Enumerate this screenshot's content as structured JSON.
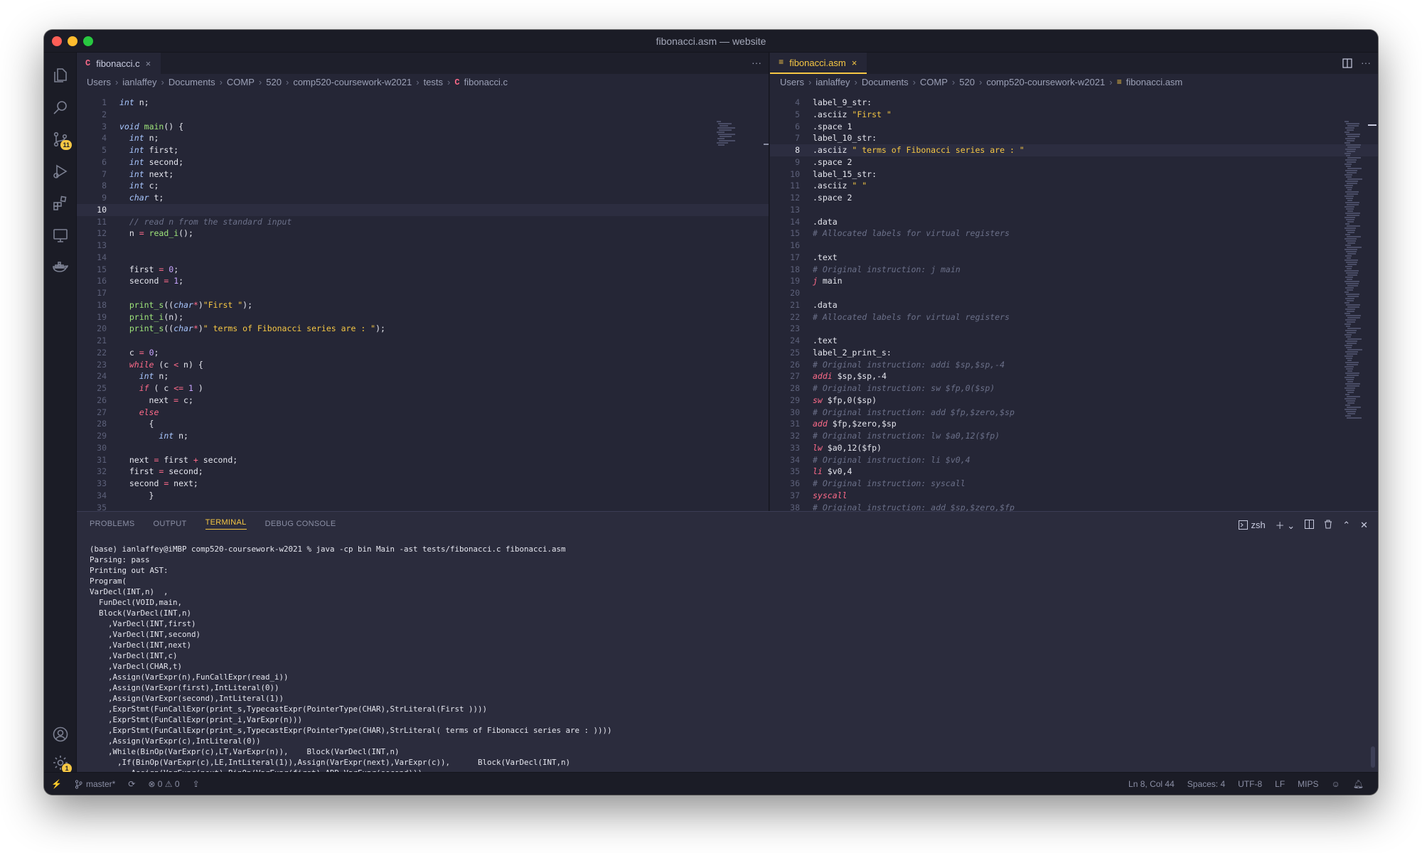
{
  "window": {
    "title": "fibonacci.asm — website"
  },
  "activity": {
    "explorer": "files-icon",
    "search": "search-icon",
    "scm": "source-control-icon",
    "scm_badge": "11",
    "run": "run-debug-icon",
    "extensions": "extensions-icon",
    "remote": "remote-explorer-icon",
    "docker": "docker-icon",
    "account": "account-icon",
    "settings": "gear-icon",
    "settings_badge": "1"
  },
  "left_editor": {
    "tab": {
      "icon": "C",
      "label": "fibonacci.c",
      "close": "×"
    },
    "more": "···",
    "breadcrumb": [
      "Users",
      "ianlaffey",
      "Documents",
      "COMP",
      "520",
      "comp520-coursework-w2021",
      "tests",
      "fibonacci.c"
    ],
    "breadcrumb_file_icon": "C",
    "current_line": 10,
    "lines": [
      {
        "n": "1",
        "html": "<span class='tok-type'>int</span> n;"
      },
      {
        "n": "2",
        "html": ""
      },
      {
        "n": "3",
        "html": "<span class='tok-type'>void</span> <span class='tok-fn'>main</span>() {"
      },
      {
        "n": "4",
        "html": "  <span class='tok-type'>int</span> n;"
      },
      {
        "n": "5",
        "html": "  <span class='tok-type'>int</span> first;"
      },
      {
        "n": "6",
        "html": "  <span class='tok-type'>int</span> second;"
      },
      {
        "n": "7",
        "html": "  <span class='tok-type'>int</span> next;"
      },
      {
        "n": "8",
        "html": "  <span class='tok-type'>int</span> c;"
      },
      {
        "n": "9",
        "html": "  <span class='tok-type'>char</span> t;"
      },
      {
        "n": "10",
        "html": ""
      },
      {
        "n": "11",
        "html": "  <span class='tok-com'>// read n from the standard input</span>"
      },
      {
        "n": "12",
        "html": "  n <span class='tok-op'>=</span> <span class='tok-fn'>read_i</span>();"
      },
      {
        "n": "13",
        "html": ""
      },
      {
        "n": "14",
        "html": ""
      },
      {
        "n": "15",
        "html": "  first <span class='tok-op'>=</span> <span class='tok-num'>0</span>;"
      },
      {
        "n": "16",
        "html": "  second <span class='tok-op'>=</span> <span class='tok-num'>1</span>;"
      },
      {
        "n": "17",
        "html": ""
      },
      {
        "n": "18",
        "html": "  <span class='tok-fn'>print_s</span>((<span class='tok-type'>char</span><span class='tok-op'>*</span>)<span class='tok-str'>\"First \"</span>);"
      },
      {
        "n": "19",
        "html": "  <span class='tok-fn'>print_i</span>(n);"
      },
      {
        "n": "20",
        "html": "  <span class='tok-fn'>print_s</span>((<span class='tok-type'>char</span><span class='tok-op'>*</span>)<span class='tok-str'>\" terms of Fibonacci series are : \"</span>);"
      },
      {
        "n": "21",
        "html": ""
      },
      {
        "n": "22",
        "html": "  c <span class='tok-op'>=</span> <span class='tok-num'>0</span>;"
      },
      {
        "n": "23",
        "html": "  <span class='tok-kw'>while</span> (c <span class='tok-op'>&lt;</span> n) {"
      },
      {
        "n": "24",
        "html": "    <span class='tok-type'>int</span> n;"
      },
      {
        "n": "25",
        "html": "    <span class='tok-kw'>if</span> ( c <span class='tok-op'>&lt;=</span> <span class='tok-num'>1</span> )"
      },
      {
        "n": "26",
        "html": "      next <span class='tok-op'>=</span> c;"
      },
      {
        "n": "27",
        "html": "    <span class='tok-kw'>else</span>"
      },
      {
        "n": "28",
        "html": "      {"
      },
      {
        "n": "29",
        "html": "        <span class='tok-type'>int</span> n;"
      },
      {
        "n": "30",
        "html": ""
      },
      {
        "n": "31",
        "html": "  next <span class='tok-op'>=</span> first <span class='tok-op'>+</span> second;"
      },
      {
        "n": "32",
        "html": "  first <span class='tok-op'>=</span> second;"
      },
      {
        "n": "33",
        "html": "  second <span class='tok-op'>=</span> next;"
      },
      {
        "n": "34",
        "html": "      }"
      },
      {
        "n": "35",
        "html": ""
      }
    ]
  },
  "right_editor": {
    "tab": {
      "icon": "≡",
      "label": "fibonacci.asm",
      "close": "×"
    },
    "split": "split-editor-icon",
    "more": "···",
    "breadcrumb": [
      "Users",
      "ianlaffey",
      "Documents",
      "COMP",
      "520",
      "comp520-coursework-w2021",
      "fibonacci.asm"
    ],
    "breadcrumb_file_icon": "≡",
    "current_line": 8,
    "lines": [
      {
        "n": "4",
        "html": "label_9_str:"
      },
      {
        "n": "5",
        "html": ".asciiz <span class='tok-str'>\"First \"</span>"
      },
      {
        "n": "6",
        "html": ".space 1"
      },
      {
        "n": "7",
        "html": "label_10_str:"
      },
      {
        "n": "8",
        "html": ".asciiz <span class='tok-str'>\" terms of Fibonacci series are : \"</span>"
      },
      {
        "n": "9",
        "html": ".space 2"
      },
      {
        "n": "10",
        "html": "label_15_str:"
      },
      {
        "n": "11",
        "html": ".asciiz <span class='tok-str'>\" \"</span>"
      },
      {
        "n": "12",
        "html": ".space 2"
      },
      {
        "n": "13",
        "html": ""
      },
      {
        "n": "14",
        "html": ".data"
      },
      {
        "n": "15",
        "html": "<span class='tok-com'># Allocated labels for virtual registers</span>"
      },
      {
        "n": "16",
        "html": ""
      },
      {
        "n": "17",
        "html": ".text"
      },
      {
        "n": "18",
        "html": "<span class='tok-com'># Original instruction: j main</span>"
      },
      {
        "n": "19",
        "html": "<span class='tok-kw'>j</span> main"
      },
      {
        "n": "20",
        "html": ""
      },
      {
        "n": "21",
        "html": ".data"
      },
      {
        "n": "22",
        "html": "<span class='tok-com'># Allocated labels for virtual registers</span>"
      },
      {
        "n": "23",
        "html": ""
      },
      {
        "n": "24",
        "html": ".text"
      },
      {
        "n": "25",
        "html": "label_2_print_s:"
      },
      {
        "n": "26",
        "html": "<span class='tok-com'># Original instruction: addi $sp,$sp,-4</span>"
      },
      {
        "n": "27",
        "html": "<span class='tok-kw'>addi</span> $sp,$sp,-4"
      },
      {
        "n": "28",
        "html": "<span class='tok-com'># Original instruction: sw $fp,0($sp)</span>"
      },
      {
        "n": "29",
        "html": "<span class='tok-kw'>sw</span> $fp,0($sp)"
      },
      {
        "n": "30",
        "html": "<span class='tok-com'># Original instruction: add $fp,$zero,$sp</span>"
      },
      {
        "n": "31",
        "html": "<span class='tok-kw'>add</span> $fp,$zero,$sp"
      },
      {
        "n": "32",
        "html": "<span class='tok-com'># Original instruction: lw $a0,12($fp)</span>"
      },
      {
        "n": "33",
        "html": "<span class='tok-kw'>lw</span> $a0,12($fp)"
      },
      {
        "n": "34",
        "html": "<span class='tok-com'># Original instruction: li $v0,4</span>"
      },
      {
        "n": "35",
        "html": "<span class='tok-kw'>li</span> $v0,4"
      },
      {
        "n": "36",
        "html": "<span class='tok-com'># Original instruction: syscall</span>"
      },
      {
        "n": "37",
        "html": "<span class='tok-kw'>syscall</span>"
      },
      {
        "n": "38",
        "html": "<span class='tok-com'># Original instruction: add $sp,$zero,$fp</span>"
      }
    ]
  },
  "panel": {
    "tabs": [
      {
        "label": "PROBLEMS",
        "active": false
      },
      {
        "label": "OUTPUT",
        "active": false
      },
      {
        "label": "TERMINAL",
        "active": true
      },
      {
        "label": "DEBUG CONSOLE",
        "active": false
      }
    ],
    "shell": "zsh",
    "terminal_lines": [
      "(base) ianlaffey@iMBP comp520-coursework-w2021 % java -cp bin Main -ast tests/fibonacci.c fibonacci.asm",
      "Parsing: pass",
      "Printing out AST:",
      "Program(",
      "VarDecl(INT,n)  ,",
      "  FunDecl(VOID,main,",
      "  Block(VarDecl(INT,n)",
      "    ,VarDecl(INT,first)",
      "    ,VarDecl(INT,second)",
      "    ,VarDecl(INT,next)",
      "    ,VarDecl(INT,c)",
      "    ,VarDecl(CHAR,t)",
      "    ,Assign(VarExpr(n),FunCallExpr(read_i))",
      "    ,Assign(VarExpr(first),IntLiteral(0))",
      "    ,Assign(VarExpr(second),IntLiteral(1))",
      "    ,ExprStmt(FunCallExpr(print_s,TypecastExpr(PointerType(CHAR),StrLiteral(First ))))",
      "    ,ExprStmt(FunCallExpr(print_i,VarExpr(n)))",
      "    ,ExprStmt(FunCallExpr(print_s,TypecastExpr(PointerType(CHAR),StrLiteral( terms of Fibonacci series are : ))))",
      "    ,Assign(VarExpr(c),IntLiteral(0))",
      "    ,While(BinOp(VarExpr(c),LT,VarExpr(n)),    Block(VarDecl(INT,n)",
      "      ,If(BinOp(VarExpr(c),LE,IntLiteral(1)),Assign(VarExpr(next),VarExpr(c)),      Block(VarDecl(INT,n)",
      "        ,Assign(VarExpr(next),BinOp(VarExpr(first),ADD,VarExpr(second)))"
    ]
  },
  "status": {
    "branch": "master*",
    "errors": "0",
    "warnings": "0",
    "position": "Ln 8, Col 44",
    "spaces": "Spaces: 4",
    "encoding": "UTF-8",
    "eol": "LF",
    "language": "MIPS"
  },
  "colors": {
    "accent": "#f6c744",
    "editor_bg": "#252636",
    "keyword": "#ff6b8a"
  }
}
